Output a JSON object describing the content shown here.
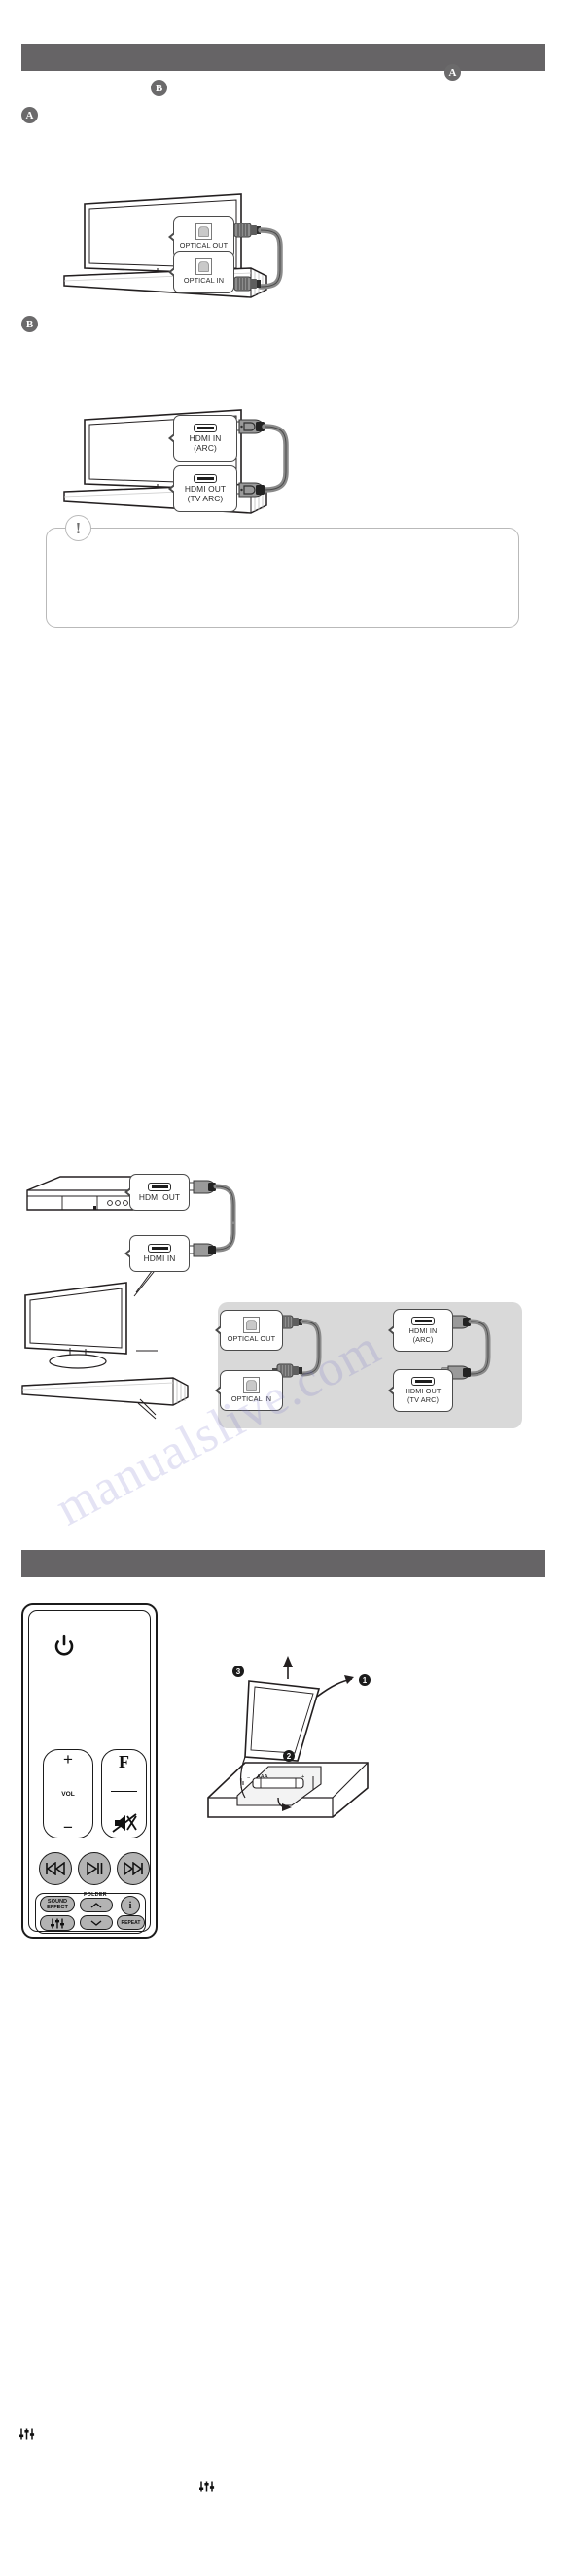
{
  "document": {
    "type": "soundbar-user-manual-page",
    "watermark": "manualslive.com"
  },
  "sections": [
    {
      "id": "tv-connection",
      "title": "",
      "bar_color": "#666466"
    },
    {
      "id": "remote-control",
      "title": "",
      "bar_color": "#666466"
    }
  ],
  "intro": {
    "option_a_badge": "A",
    "option_b_badge": "B"
  },
  "option_a": {
    "badge": "A",
    "tv_port": {
      "icon": "optical-port-icon",
      "label": "OPTICAL OUT"
    },
    "bar_port": {
      "icon": "optical-port-icon",
      "label": "OPTICAL IN"
    },
    "cable": "optical-cable"
  },
  "option_b": {
    "badge": "B",
    "tv_port": {
      "icon": "hdmi-port-icon",
      "label_line1": "HDMI IN",
      "label_line2": "(ARC)"
    },
    "bar_port": {
      "icon": "hdmi-port-icon",
      "label_line1": "HDMI OUT",
      "label_line2": "(TV ARC)"
    },
    "cable": "hdmi-cable"
  },
  "note": {
    "icon": "exclamation-icon",
    "icon_glyph": "!",
    "text": ""
  },
  "combined_figure": {
    "player_port": {
      "icon": "hdmi-port-icon",
      "label": "HDMI OUT"
    },
    "tv_hdmi_in": {
      "icon": "hdmi-port-icon",
      "label": "HDMI IN"
    },
    "tv_optical_out": {
      "icon": "optical-port-icon",
      "label": "OPTICAL OUT"
    },
    "bar_optical_in": {
      "icon": "optical-port-icon",
      "label": "OPTICAL IN"
    },
    "tv_hdmi_arc": {
      "icon": "hdmi-port-icon",
      "label_line1": "HDMI IN",
      "label_line2": "(ARC)"
    },
    "bar_hdmi_arc": {
      "icon": "hdmi-port-icon",
      "label_line1": "HDMI OUT",
      "label_line2": "(TV ARC)"
    }
  },
  "remote": {
    "power_button": {
      "icon": "power-icon",
      "label": ""
    },
    "volume_button": {
      "plus": "+",
      "label": "VOL",
      "minus": "−"
    },
    "function_button": {
      "letter": "F",
      "mute_icon": "mute-icon"
    },
    "prev_button": {
      "icon": "previous-track-icon"
    },
    "play_pause_button": {
      "icon": "play-pause-icon"
    },
    "next_button": {
      "icon": "next-track-icon"
    },
    "sound_effect_button": {
      "line1": "SOUND",
      "line2": "EFFECT"
    },
    "folder_label": "FOLDER",
    "folder_up_button": {
      "icon": "chevron-up-icon"
    },
    "folder_down_button": {
      "icon": "chevron-down-icon"
    },
    "info_button": {
      "icon": "info-icon",
      "glyph": "i"
    },
    "equalizer_button": {
      "icon": "equalizer-icon"
    },
    "repeat_button": {
      "label": "REPEAT"
    }
  },
  "battery": {
    "step1": "1",
    "step2": "2",
    "step3": "3",
    "battery_label": "AAA",
    "battery_polarity_minus": "−",
    "battery_polarity_plus": "+"
  },
  "footer_icons": {
    "icon_left": "equalizer-icon",
    "icon_right": "equalizer-icon"
  },
  "colors": {
    "header_bar": "#666466",
    "badge": "#6b6a6b",
    "gray_region": "#d9d9d9",
    "line": "#231f20",
    "note_border": "#b9b9b9",
    "button_fill": "#b3b3b3",
    "watermark": "#7a74c8"
  }
}
